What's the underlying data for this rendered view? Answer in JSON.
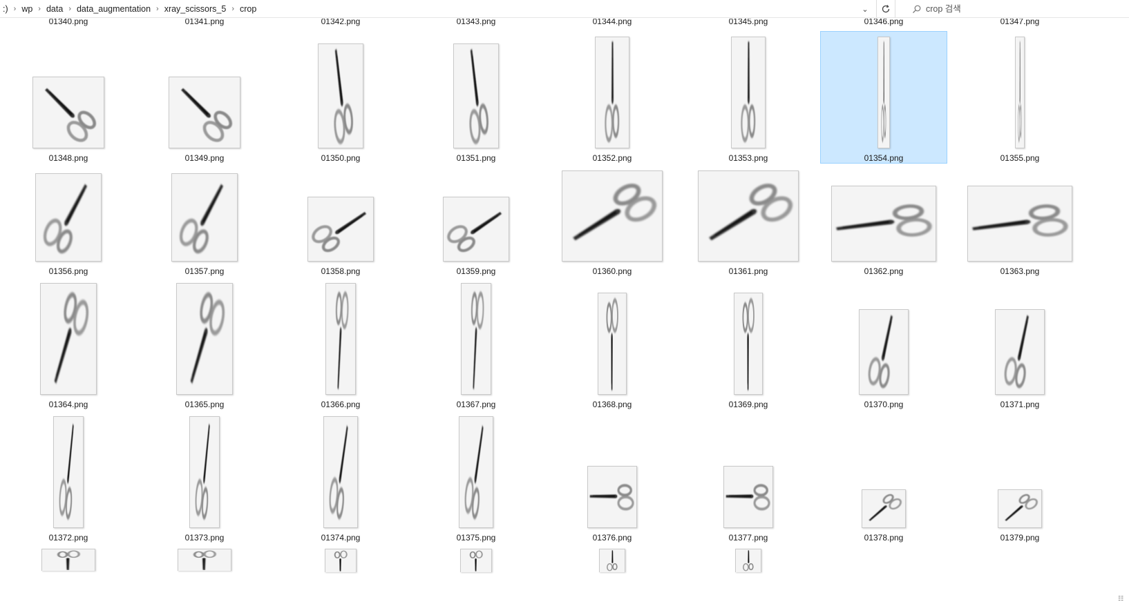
{
  "breadcrumb": [
    ":)",
    "wp",
    "data",
    "data_augmentation",
    "xray_scissors_5",
    "crop"
  ],
  "search": {
    "placeholder": "crop 검색"
  },
  "icons": {
    "dropdown": "chevron-down-icon",
    "refresh": "refresh-icon",
    "search": "search-icon",
    "separator": "chevron-right-icon"
  },
  "selection_color": "#cce8ff",
  "clipped_row": [
    "01340.png",
    "01341.png",
    "01342.png",
    "01343.png",
    "01344.png",
    "01345.png",
    "01346.png",
    "01347.png"
  ],
  "rows": [
    [
      "01348.png",
      "01349.png",
      "01350.png",
      "01351.png",
      "01352.png",
      "01353.png",
      "01354.png",
      "01355.png"
    ],
    [
      "01356.png",
      "01357.png",
      "01358.png",
      "01359.png",
      "01360.png",
      "01361.png",
      "01362.png",
      "01363.png"
    ],
    [
      "01364.png",
      "01365.png",
      "01366.png",
      "01367.png",
      "01368.png",
      "01369.png",
      "01370.png",
      "01371.png"
    ],
    [
      "01372.png",
      "01373.png",
      "01374.png",
      "01375.png",
      "01376.png",
      "01377.png",
      "01378.png",
      "01379.png"
    ]
  ],
  "selected_file": "01354.png"
}
